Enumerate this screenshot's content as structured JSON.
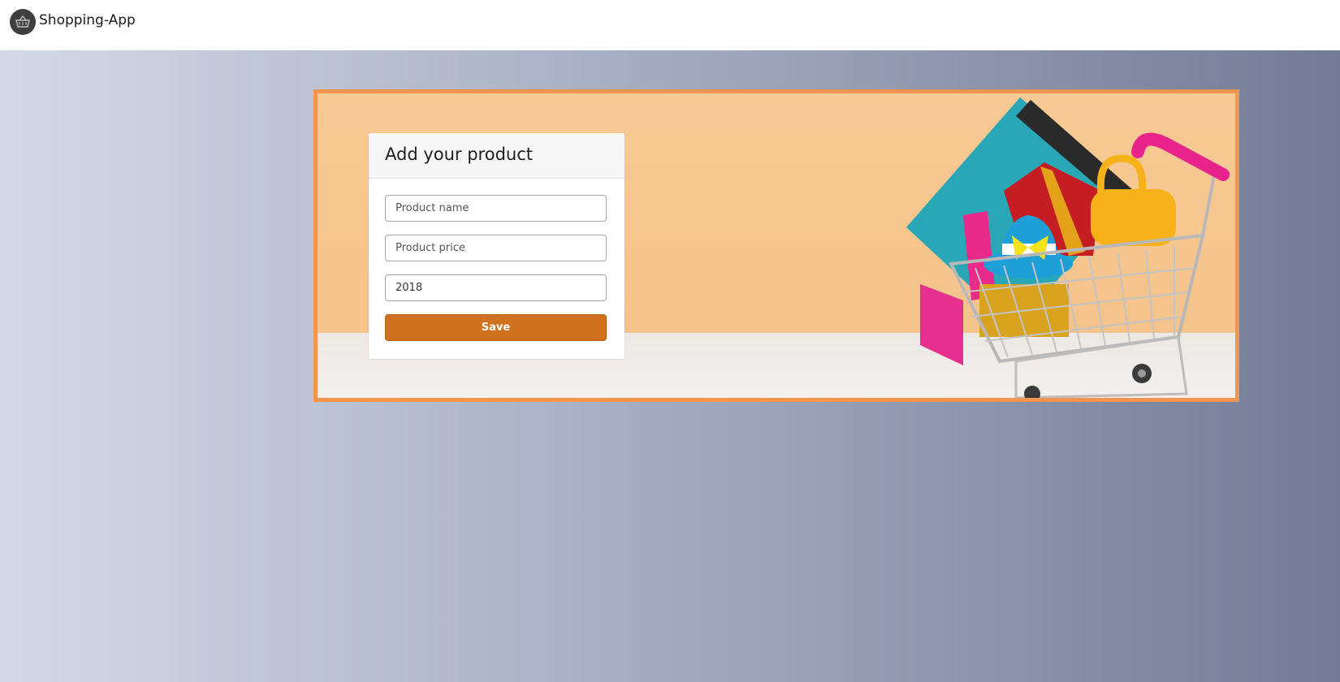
{
  "navbar": {
    "brand_label": "Shopping-App",
    "brand_icon": "basket-icon"
  },
  "hero": {
    "image": "shopping-cart-photo"
  },
  "form": {
    "title": "Add your product",
    "product_name_placeholder": "Product name",
    "product_price_placeholder": "Product price",
    "year_value": "2018",
    "save_label": "Save"
  },
  "colors": {
    "accent_orange": "#cf711f",
    "hero_border": "#f2954f",
    "hero_background": "#f7c994"
  }
}
